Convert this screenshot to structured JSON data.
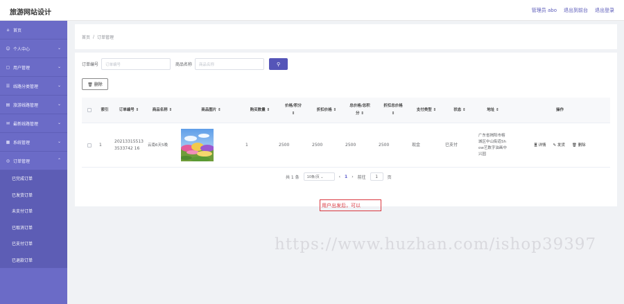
{
  "app": {
    "title": "旅游网站设计"
  },
  "top_links": {
    "admin": "管理员 abo",
    "backend": "退出到前台",
    "logout": "退出登录"
  },
  "sidebar": {
    "items": [
      {
        "label": "首页",
        "icon": "home-icon",
        "glyph": "⌂",
        "arrow": ""
      },
      {
        "label": "个人中心",
        "icon": "user-icon",
        "glyph": "☺",
        "arrow": "⌄"
      },
      {
        "label": "用户管理",
        "icon": "users-icon",
        "glyph": "▢",
        "arrow": "⌄"
      },
      {
        "label": "线路分类管理",
        "icon": "tag-icon",
        "glyph": "☰",
        "arrow": "⌄"
      },
      {
        "label": "旅游线路管理",
        "icon": "route-icon",
        "glyph": "▤",
        "arrow": "⌄"
      },
      {
        "label": "最新线路管理",
        "icon": "mail-icon",
        "glyph": "✉",
        "arrow": "⌄"
      },
      {
        "label": "系统管理",
        "icon": "system-icon",
        "glyph": "▦",
        "arrow": "⌄"
      },
      {
        "label": "订单管理",
        "icon": "order-icon",
        "glyph": "◎",
        "arrow": "⌃"
      }
    ],
    "sub_items": [
      "已完成订单",
      "已发货订单",
      "未支付订单",
      "已取消订单",
      "已支付订单",
      "已退款订单"
    ]
  },
  "breadcrumb": {
    "home": "首页",
    "separator": "/",
    "current": "订单管理"
  },
  "search": {
    "order_no_label": "订单编号",
    "order_no_placeholder": "订单编号",
    "product_label": "商品名称",
    "product_placeholder": "商品名称",
    "search_icon": "search-icon",
    "search_glyph": "⚲"
  },
  "toolbar": {
    "delete_label": "🗑 删除"
  },
  "table": {
    "headers": {
      "index": "索引",
      "order_no": "订单编号 ⇕",
      "name": "商品名称 ⇕",
      "image": "商品图片 ⇕",
      "qty": "购买数量 ⇕",
      "price_l1": "价格/积分",
      "price_l2": "⇕",
      "discount": "折扣价格 ⇕",
      "total_l1": "总价格/总积",
      "total_l2": "分 ⇕",
      "total_disc_l1": "折扣总价格",
      "total_disc_l2": "⇕",
      "paytype": "支付类型 ⇕",
      "status": "状态 ⇕",
      "address": "地址 ⇕",
      "ops": "操作"
    },
    "rows": [
      {
        "index": "1",
        "order_no": "202133155133533742 16",
        "name": "云南6天5晚",
        "qty": "1",
        "price": "2500",
        "discount": "2500",
        "total": "2500",
        "total_discount": "2500",
        "paytype": "现金",
        "status": "已支付",
        "address": "广东省揭阳市榕城区中山街道Show艺数字油画中兴园",
        "ops": {
          "detail": "🗏 详情",
          "ship": "✎ 发货",
          "delete": "🗑 删除"
        }
      }
    ]
  },
  "pagination": {
    "total": "共 1 条",
    "page_size": "10条/页 ⌄",
    "prev": "‹",
    "current": "1",
    "next": "›",
    "goto": "前往",
    "page_input": "1",
    "page_unit": "页"
  },
  "note": "用户出发后，可以",
  "watermark": "https://www.huzhan.com/ishop39397"
}
